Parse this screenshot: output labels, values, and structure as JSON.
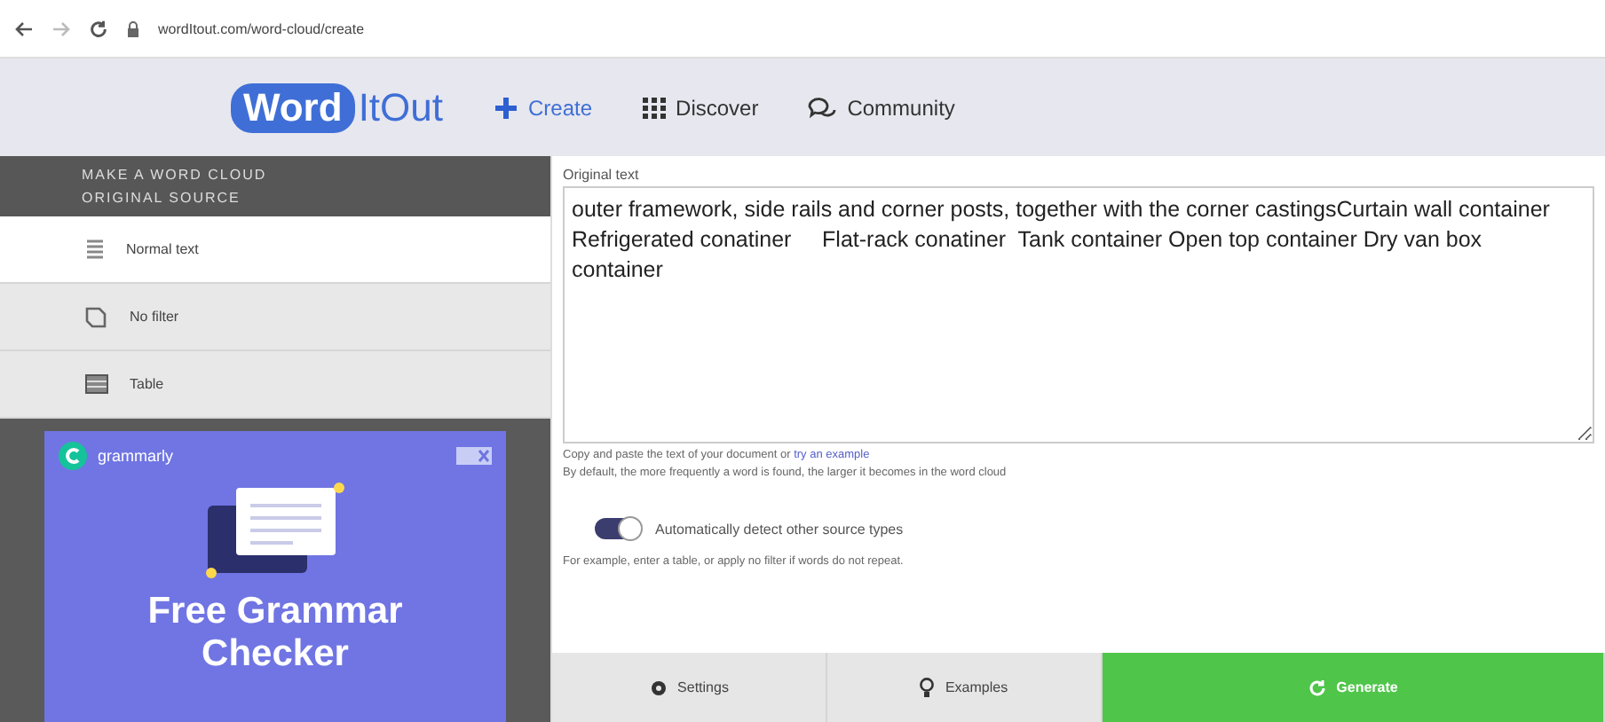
{
  "browser": {
    "url": "wordItout.com/word-cloud/create"
  },
  "nav": {
    "logo_word": "Word",
    "logo_rest": "ItOut",
    "items": [
      {
        "label": "Create",
        "kind": "plus"
      },
      {
        "label": "Discover",
        "kind": "grid"
      },
      {
        "label": "Community",
        "kind": "chat"
      }
    ]
  },
  "sidebar": {
    "heading": "MAKE A WORD CLOUD",
    "subheading": "ORIGINAL SOURCE",
    "items": [
      {
        "label": "Normal text",
        "kind": "text",
        "selected": true
      },
      {
        "label": "No filter",
        "kind": "filter",
        "selected": false
      },
      {
        "label": "Table",
        "kind": "table",
        "selected": false
      }
    ]
  },
  "ad": {
    "brand": "grammarly",
    "headline": "Free Grammar Checker"
  },
  "editor": {
    "label": "Original text",
    "value": "outer framework, side rails and corner posts, together with the corner castingsCurtain wall container  Refrigerated conatiner     Flat-rack conatiner  Tank container Open top container Dry van box container",
    "hint": "Copy and paste the text of your document or",
    "hint_link": "try an example",
    "note": "By default, the more frequently a word is found, the larger it becomes in the word cloud"
  },
  "toggle": {
    "label": "Automatically detect other source types",
    "on": true
  },
  "example_note": "For example, enter a table, or apply no filter if words do not repeat.",
  "actions": [
    {
      "label": "Settings",
      "kind": "settings"
    },
    {
      "label": "Examples",
      "kind": "examples"
    },
    {
      "label": "Generate",
      "kind": "generate"
    }
  ]
}
